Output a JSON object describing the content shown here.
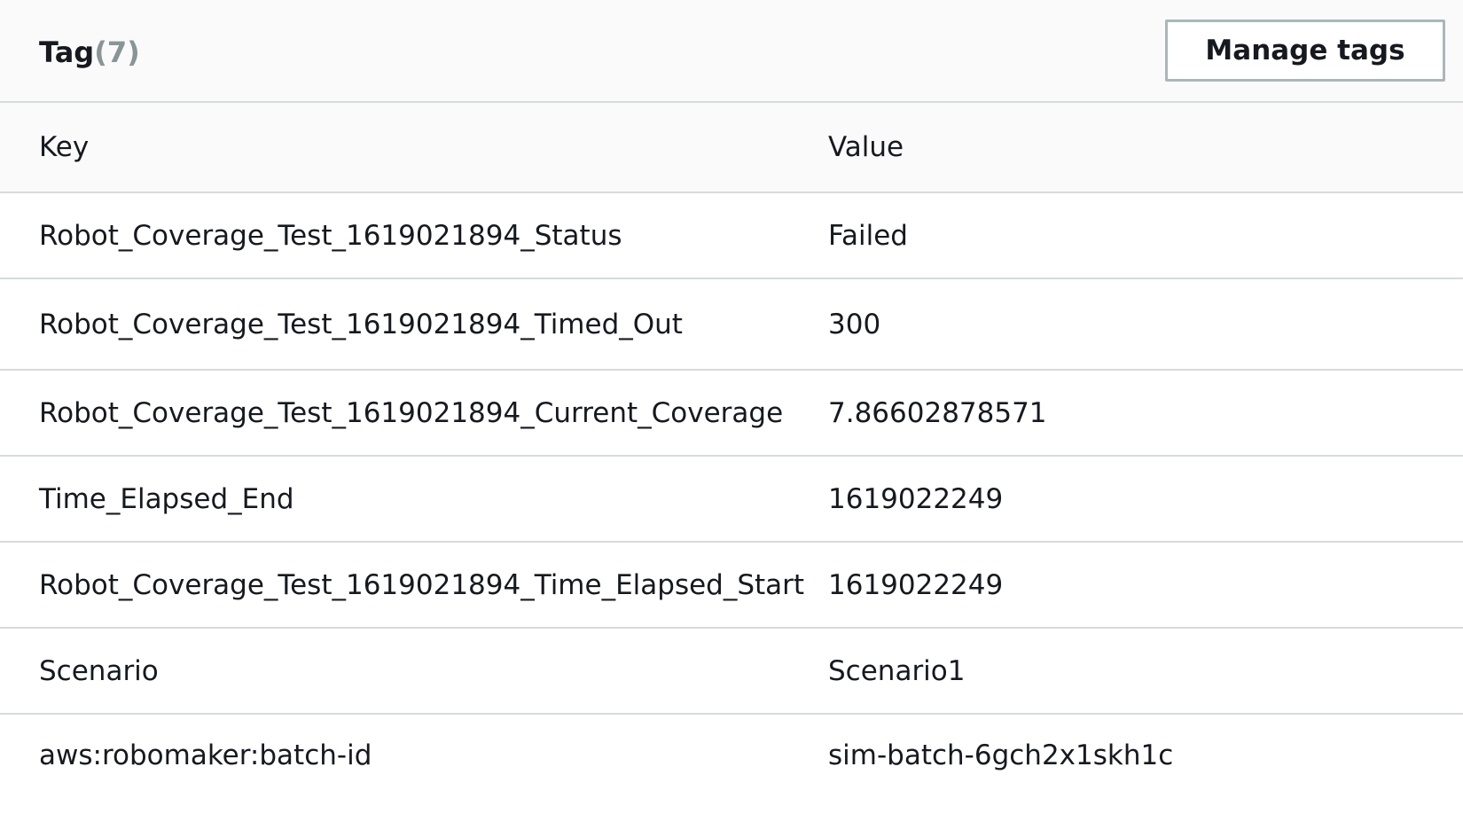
{
  "header": {
    "title": "Tag",
    "count": "(7)",
    "manage_button_label": "Manage tags"
  },
  "table": {
    "columns": [
      "Key",
      "Value"
    ],
    "rows": [
      {
        "key": "Robot_Coverage_Test_1619021894_Status",
        "value": "Failed"
      },
      {
        "key": "Robot_Coverage_Test_1619021894_Timed_Out",
        "value": "300"
      },
      {
        "key": "Robot_Coverage_Test_1619021894_Current_Coverage",
        "value": "7.86602878571"
      },
      {
        "key": "Time_Elapsed_End",
        "value": "1619022249"
      },
      {
        "key": "Robot_Coverage_Test_1619021894_Time_Elapsed_Start",
        "value": "1619022249"
      },
      {
        "key": "Scenario",
        "value": "Scenario1"
      },
      {
        "key": "aws:robomaker:batch-id",
        "value": "sim-batch-6gch2x1skh1c"
      }
    ]
  }
}
